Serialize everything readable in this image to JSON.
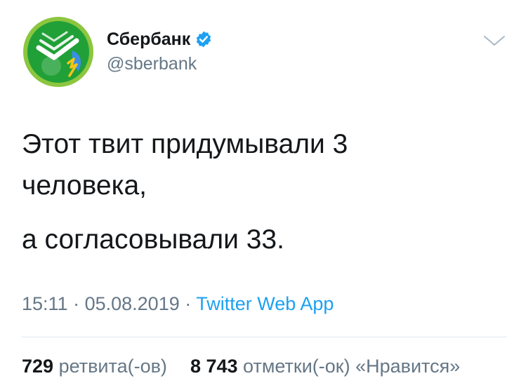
{
  "account": {
    "display_name": "Сбербанк",
    "handle": "@sberbank",
    "verified": true,
    "avatar_icon": "sberbank-logo-icon"
  },
  "tweet": {
    "paragraph1_line1": "Этот твит придумывали 3",
    "paragraph1_line2": "человека,",
    "paragraph2": "а согласовывали 33."
  },
  "meta": {
    "time": "15:11",
    "separator": "·",
    "date": "05.08.2019",
    "source": "Twitter Web App"
  },
  "stats": {
    "retweets_count": "729",
    "retweets_label": "ретвита(-ов)",
    "likes_count": "8 743",
    "likes_label": "отметки(-ок) «Нравится»"
  },
  "colors": {
    "text": "#14171a",
    "secondary": "#657786",
    "link": "#1da1f2",
    "verified": "#1da1f2",
    "brand_green": "#21a038"
  },
  "icons": {
    "verified": "verified-badge-icon",
    "menu": "chevron-down-icon"
  }
}
